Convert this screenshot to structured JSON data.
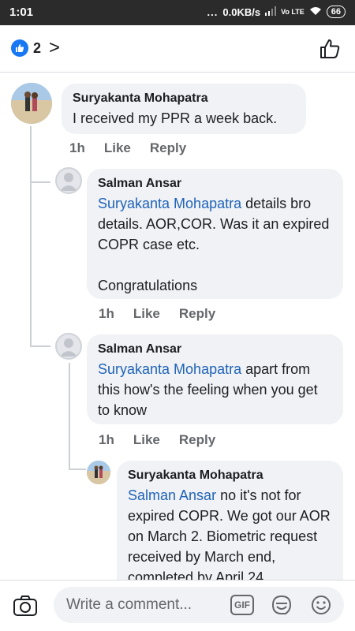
{
  "status_bar": {
    "time": "1:01",
    "dots": "...",
    "speed": "0.0KB/s",
    "network": "Vo LTE",
    "battery": "66"
  },
  "header": {
    "reaction_count": "2",
    "chevron": ">"
  },
  "comments": [
    {
      "author": "Suryakanta Mohapatra",
      "mention": "",
      "text": "I received my PPR a week back.",
      "time": "1h",
      "like": "Like",
      "reply": "Reply"
    },
    {
      "author": "Salman Ansar",
      "mention": "Suryakanta Mohapatra",
      "text": " details bro details. AOR,COR. Was it an expired COPR case etc.",
      "text2": "Congratulations",
      "time": "1h",
      "like": "Like",
      "reply": "Reply"
    },
    {
      "author": "Salman Ansar",
      "mention": "Suryakanta Mohapatra",
      "text": " apart from this how's the feeling when you get to know",
      "time": "1h",
      "like": "Like",
      "reply": "Reply"
    },
    {
      "author": "Suryakanta Mohapatra",
      "mention": "Salman Ansar",
      "text": " no it's not for expired COPR. We got our AOR on March 2. Biometric request received by March end, completed by April 24"
    }
  ],
  "composer": {
    "placeholder": "Write a comment...",
    "gif_label": "GIF"
  },
  "colors": {
    "accent": "#1877f2",
    "mention": "#1f63b8",
    "bubble": "#f0f2f5",
    "meta": "#65676b"
  }
}
